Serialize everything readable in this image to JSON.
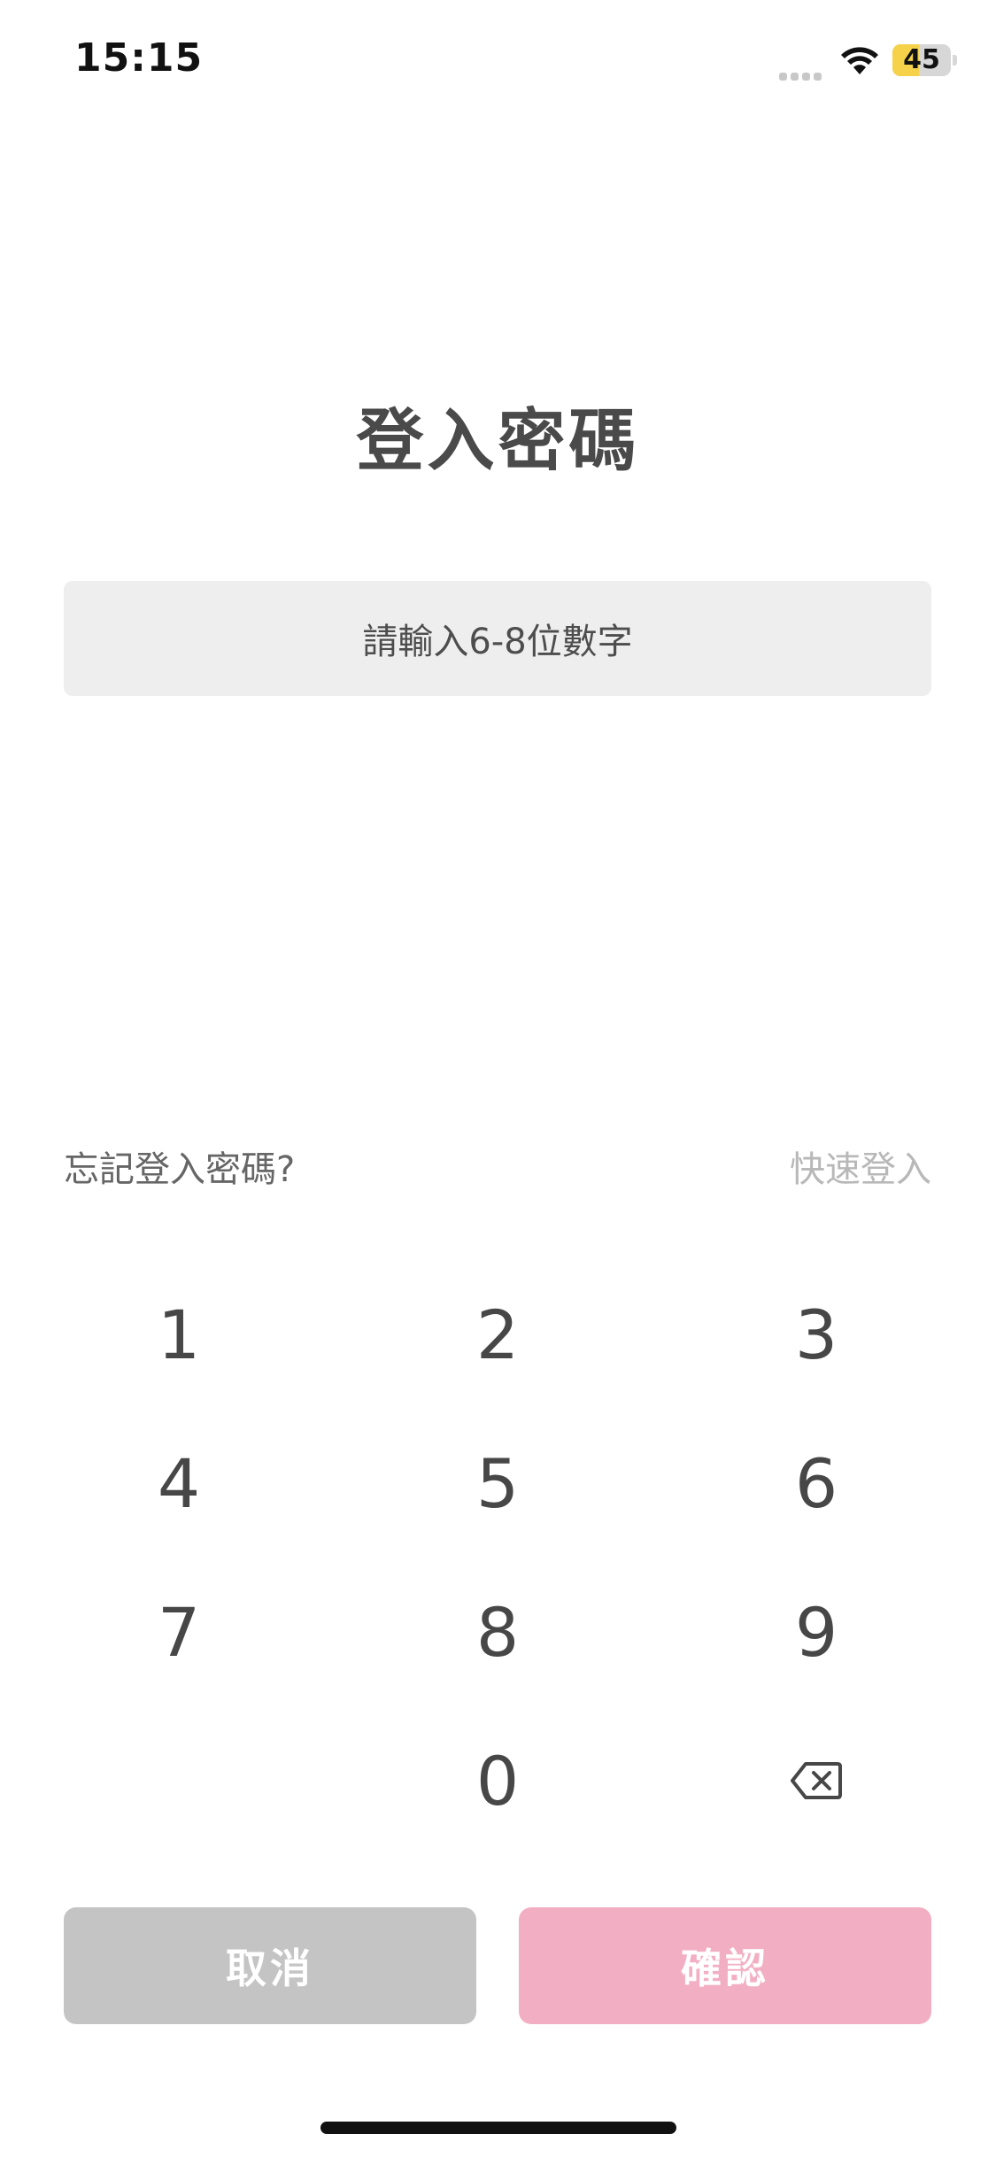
{
  "status_bar": {
    "time": "15:15",
    "battery_level": 45,
    "battery_text": "45",
    "icons": [
      "signal-dots-icon",
      "wifi-icon",
      "battery-icon"
    ],
    "battery_color": "#f5d24a"
  },
  "page": {
    "title": "登入密碼"
  },
  "password": {
    "placeholder": "請輸入6-8位數字",
    "value": ""
  },
  "links": {
    "forgot": "忘記登入密碼?",
    "quick_login": "快速登入"
  },
  "keypad": {
    "keys": [
      "1",
      "2",
      "3",
      "4",
      "5",
      "6",
      "7",
      "8",
      "9",
      "0"
    ],
    "delete_icon": "backspace-icon"
  },
  "buttons": {
    "cancel_label": "取消",
    "confirm_label": "確認",
    "cancel_color": "#c4c4c4",
    "confirm_color": "#f2afc3"
  },
  "colors": {
    "field_background": "#eeeeee",
    "title_text": "#4a4a4a",
    "quick_login_text": "#b8b8b8"
  }
}
